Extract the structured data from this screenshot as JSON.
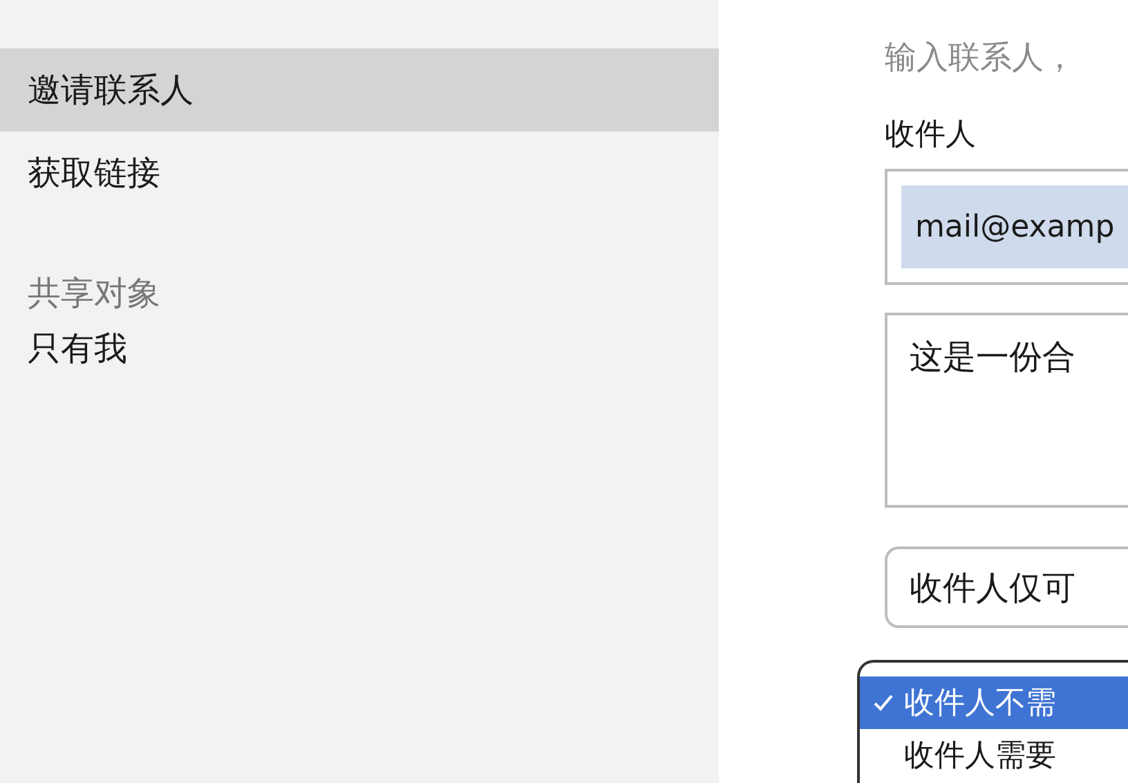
{
  "sidebar": {
    "items": [
      {
        "label": "邀请联系人",
        "selected": true
      },
      {
        "label": "获取链接",
        "selected": false
      }
    ],
    "section_title": "共享对象",
    "section_items": [
      {
        "label": "只有我"
      }
    ]
  },
  "form": {
    "hint": "输入联系人，",
    "recipients_label": "收件人",
    "recipients": [
      {
        "label": "mail@examp"
      }
    ],
    "message": "这是一份合",
    "permission": "收件人仅可"
  },
  "menu": {
    "options": [
      {
        "label": "收件人不需",
        "selected": true,
        "checked": true
      },
      {
        "label": "收件人需要",
        "selected": false,
        "checked": false
      }
    ]
  }
}
